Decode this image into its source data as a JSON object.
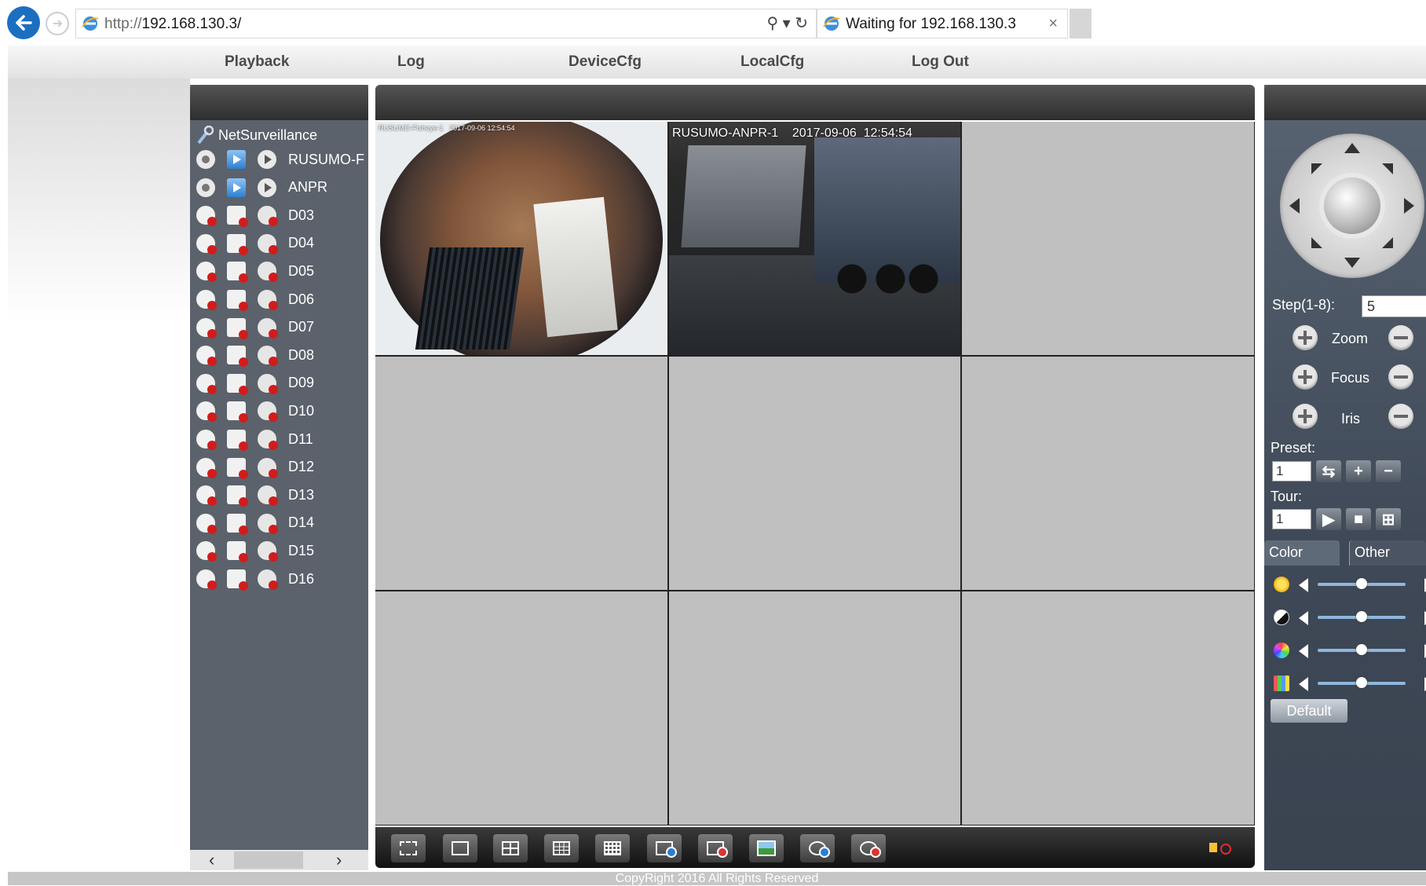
{
  "browser": {
    "url_prefix": "http://",
    "url_host": "192.168.130.3/",
    "tab_title": "Waiting for 192.168.130.3",
    "tab_close": "×",
    "addr_tools": "⚲ ▾ ↻"
  },
  "menu": {
    "items": [
      "Playback",
      "Log",
      "DeviceCfg",
      "LocalCfg",
      "Log Out"
    ]
  },
  "tree": {
    "root_label": "NetSurveillance",
    "channels": [
      {
        "label": "RUSUMO-F",
        "state": "online"
      },
      {
        "label": "ANPR",
        "state": "online"
      },
      {
        "label": "D03",
        "state": "offline"
      },
      {
        "label": "D04",
        "state": "offline"
      },
      {
        "label": "D05",
        "state": "offline"
      },
      {
        "label": "D06",
        "state": "offline"
      },
      {
        "label": "D07",
        "state": "offline"
      },
      {
        "label": "D08",
        "state": "offline"
      },
      {
        "label": "D09",
        "state": "offline"
      },
      {
        "label": "D10",
        "state": "offline"
      },
      {
        "label": "D11",
        "state": "offline"
      },
      {
        "label": "D12",
        "state": "offline"
      },
      {
        "label": "D13",
        "state": "offline"
      },
      {
        "label": "D14",
        "state": "offline"
      },
      {
        "label": "D15",
        "state": "offline"
      },
      {
        "label": "D16",
        "state": "offline"
      }
    ],
    "scroll_left": "‹",
    "scroll_right": "›"
  },
  "video": {
    "cam1_osd": "RUSUMO-Fisheye-1   2017-09-06 12:54:54",
    "cam2_osd": "RUSUMO-ANPR-1    2017-09-06  12:54:54"
  },
  "ptz": {
    "step_label": "Step(1-8):",
    "step_value": "5",
    "zoom_label": "Zoom",
    "focus_label": "Focus",
    "iris_label": "Iris",
    "preset_label": "Preset:",
    "preset_value": "1",
    "tour_label": "Tour:",
    "tour_value": "1"
  },
  "color_tabs": [
    "Color",
    "Other"
  ],
  "sliders": [
    {
      "name": "brightness",
      "value": 0.5
    },
    {
      "name": "contrast",
      "value": 0.5
    },
    {
      "name": "saturation",
      "value": 0.5
    },
    {
      "name": "hue",
      "value": 0.5
    }
  ],
  "default_label": "Default",
  "footer": "CopyRight 2016 All Rights Reserved"
}
